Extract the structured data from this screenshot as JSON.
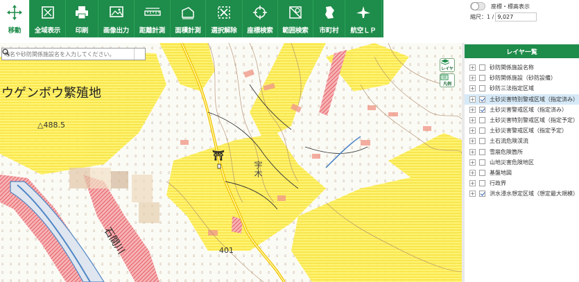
{
  "toolbar": {
    "items": [
      {
        "label": "移動",
        "icon": "move-icon",
        "active": true
      },
      {
        "label": "全域表示",
        "icon": "full-extent-icon"
      },
      {
        "label": "印刷",
        "icon": "printer-icon"
      },
      {
        "label": "画像出力",
        "icon": "image-export-icon"
      },
      {
        "label": "距離計測",
        "icon": "distance-ruler-icon"
      },
      {
        "label": "面積計測",
        "icon": "area-measure-icon"
      },
      {
        "label": "選択解除",
        "icon": "clear-selection-icon"
      },
      {
        "label": "座標検索",
        "icon": "crosshair-icon"
      },
      {
        "label": "範囲検索",
        "icon": "range-search-icon"
      },
      {
        "label": "市町村",
        "icon": "municipality-icon"
      },
      {
        "label": "航空ＬＰ",
        "icon": "aerial-lp-icon"
      }
    ],
    "colors": {
      "background": "#1e8c4a",
      "active_background": "#ffffff"
    }
  },
  "top_controls": {
    "toggle_label": "座標・標高表示",
    "scale_label": "縮尺：1 /",
    "scale_value": "9,027"
  },
  "map": {
    "search_placeholder": "地名や砂防関係施設名を入力してください。",
    "buttons": {
      "layers": "レイヤ",
      "legend": "凡例"
    },
    "labels": {
      "place1": "ウゲンボウ繁殖地",
      "elev1": "△488.5",
      "place2": "宇木",
      "elev2": "401",
      "river": "石間川"
    },
    "colors": {
      "hazard_yellow": "#fff36b",
      "hazard_red": "#e0474f",
      "contour": "#b08a6a",
      "water": "#4f86c6",
      "road": "#f2c400"
    }
  },
  "layer_panel": {
    "header": "レイヤ一覧",
    "layers": [
      {
        "label": "砂防関係施設名称",
        "checked": false,
        "expandable": true
      },
      {
        "label": "砂防関係施設（砂防設備）",
        "checked": false,
        "expandable": true
      },
      {
        "label": "砂防三法指定区域",
        "checked": false,
        "expandable": true
      },
      {
        "label": "土砂災害特別警戒区域（指定済み）",
        "checked": true,
        "expandable": true,
        "selected": true
      },
      {
        "label": "土砂災害警戒区域（指定済み）",
        "checked": true,
        "expandable": true
      },
      {
        "label": "土砂災害特別警戒区域（指定予定）",
        "checked": false,
        "expandable": true
      },
      {
        "label": "土砂災害警戒区域（指定予定）",
        "checked": false,
        "expandable": true
      },
      {
        "label": "土石流危険渓流",
        "checked": false,
        "expandable": true
      },
      {
        "label": "雪崩危険箇所",
        "checked": false,
        "expandable": true
      },
      {
        "label": "山地災害危険地区",
        "checked": false,
        "expandable": true
      },
      {
        "label": "基盤地図",
        "checked": false,
        "expandable": true
      },
      {
        "label": "行政界",
        "checked": false,
        "expandable": true
      },
      {
        "label": "洪水浸水想定区域（想定最大規模）",
        "checked": true,
        "expandable": true
      }
    ]
  }
}
